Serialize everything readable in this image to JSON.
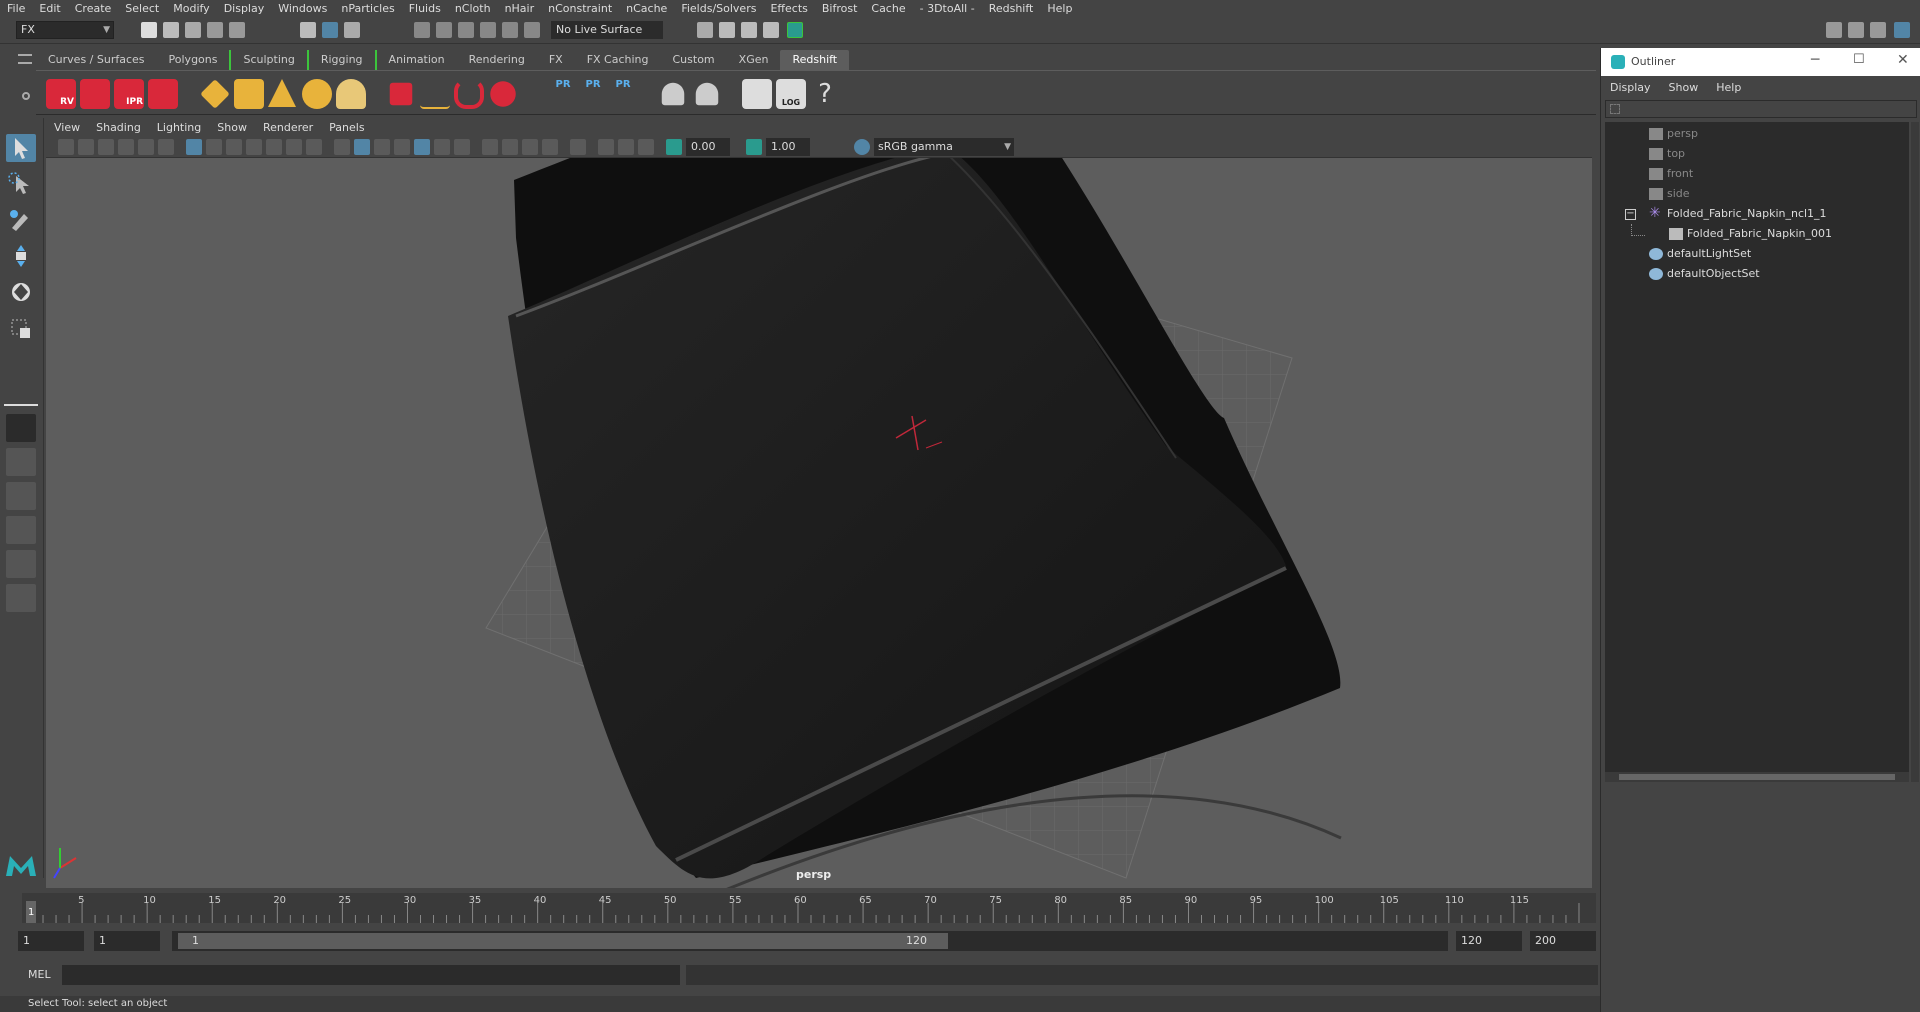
{
  "menubar": [
    "File",
    "Edit",
    "Create",
    "Select",
    "Modify",
    "Display",
    "Windows",
    "nParticles",
    "Fluids",
    "nCloth",
    "nHair",
    "nConstraint",
    "nCache",
    "Fields/Solvers",
    "Effects",
    "Bifrost",
    "Cache",
    "- 3DtoAll -",
    "Redshift",
    "Help"
  ],
  "statusline": {
    "mode": "FX",
    "live_surface": "No Live Surface"
  },
  "shelf_tabs": [
    "Curves / Surfaces",
    "Polygons",
    "Sculpting",
    "Rigging",
    "Animation",
    "Rendering",
    "FX",
    "FX Caching",
    "Custom",
    "XGen",
    "Redshift"
  ],
  "shelf_active": "Redshift",
  "shelf_labels": {
    "rv": "RV",
    "ipr": "IPR",
    "pr1": "PR",
    "pr2": "PR",
    "pr3": "PR",
    "log": "LOG",
    "help": "?"
  },
  "panel_menu": [
    "View",
    "Shading",
    "Lighting",
    "Show",
    "Renderer",
    "Panels"
  ],
  "panel_toolbar": {
    "exposure": "0.00",
    "gamma_value": "1.00",
    "color_space": "sRGB gamma"
  },
  "viewport": {
    "camera_label": "persp"
  },
  "timeline": {
    "ticks": [
      "5",
      "10",
      "15",
      "20",
      "25",
      "30",
      "35",
      "40",
      "45",
      "50",
      "55",
      "60",
      "65",
      "70",
      "75",
      "80",
      "85",
      "90",
      "95",
      "100",
      "105",
      "110",
      "115"
    ],
    "current_frame": "1"
  },
  "range": {
    "start": "1",
    "anim_start": "1",
    "slider_start": "1",
    "slider_end": "120",
    "end": "120",
    "anim_end": "200"
  },
  "command": {
    "language": "MEL"
  },
  "help_line": "Select Tool: select an object",
  "outliner": {
    "title": "Outliner",
    "menu": [
      "Display",
      "Show",
      "Help"
    ],
    "items": [
      {
        "label": "persp",
        "dim": true
      },
      {
        "label": "top",
        "dim": true
      },
      {
        "label": "front",
        "dim": true
      },
      {
        "label": "side",
        "dim": true
      },
      {
        "label": "Folded_Fabric_Napkin_ncl1_1",
        "dim": false
      },
      {
        "label": "Folded_Fabric_Napkin_001",
        "dim": false
      },
      {
        "label": "defaultLightSet",
        "dim": false
      },
      {
        "label": "defaultObjectSet",
        "dim": false
      }
    ]
  },
  "colors": {
    "accent": "#5285a6",
    "redshift_red": "#d9283a",
    "active_tab_border": "#3cc43c"
  }
}
